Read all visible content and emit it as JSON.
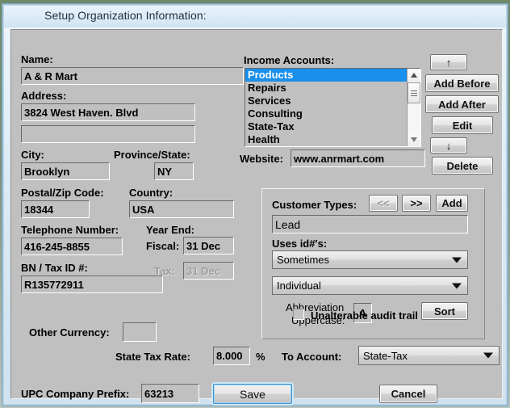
{
  "window": {
    "title": "Setup Organization Information:"
  },
  "org": {
    "name_label": "Name:",
    "name_value": "A & R Mart",
    "address_label": "Address:",
    "address1_value": "3824 West Haven. Blvd",
    "address2_value": "",
    "city_label": "City:",
    "city_value": "Brooklyn",
    "province_label": "Province/State:",
    "province_value": "NY",
    "postal_label": "Postal/Zip Code:",
    "postal_value": "18344",
    "country_label": "Country:",
    "country_value": "USA",
    "telephone_label": "Telephone Number:",
    "telephone_value": "416-245-8855",
    "year_end_label": "Year End:",
    "fiscal_label": "Fiscal:",
    "fiscal_value": "31 Dec",
    "tax_label": "Tax:",
    "tax_value": "31 Dec",
    "bn_label": "BN / Tax ID #:",
    "bn_value": "R135772911"
  },
  "income": {
    "label": "Income Accounts:",
    "items": [
      "Products",
      "Repairs",
      "Services",
      "Consulting",
      "State-Tax",
      "Health"
    ],
    "selected_index": 0,
    "buttons": {
      "move_up": "↑",
      "add_before": "Add Before",
      "add_after": "Add After",
      "edit": "Edit",
      "move_down": "↓",
      "delete": "Delete"
    }
  },
  "website": {
    "label": "Website:",
    "value": "www.anrmart.com"
  },
  "customer_types": {
    "label": "Customer Types:",
    "prev_label": "<<",
    "next_label": ">>",
    "add_label": "Add",
    "value": "Lead",
    "uses_ids_label": "Uses id#'s:",
    "uses_ids_value": "Sometimes",
    "entity_value": "Individual",
    "abbrev_label_line1": "Abbreviation",
    "abbrev_label_line2": "Uppercase:",
    "abbrev_value": "A",
    "sort_label": "Sort"
  },
  "audit": {
    "checkbox_label": "Unalterable audit trail",
    "checked": false
  },
  "footer": {
    "other_currency_label": "Other Currency:",
    "other_currency_value": "",
    "state_tax_rate_label": "State Tax Rate:",
    "state_tax_rate_value": "8.000",
    "percent_symbol": "%",
    "to_account_label": "To Account:",
    "to_account_value": "State-Tax",
    "upc_label": "UPC Company Prefix:",
    "upc_value": "63213",
    "save_label": "Save",
    "cancel_label": "Cancel"
  }
}
